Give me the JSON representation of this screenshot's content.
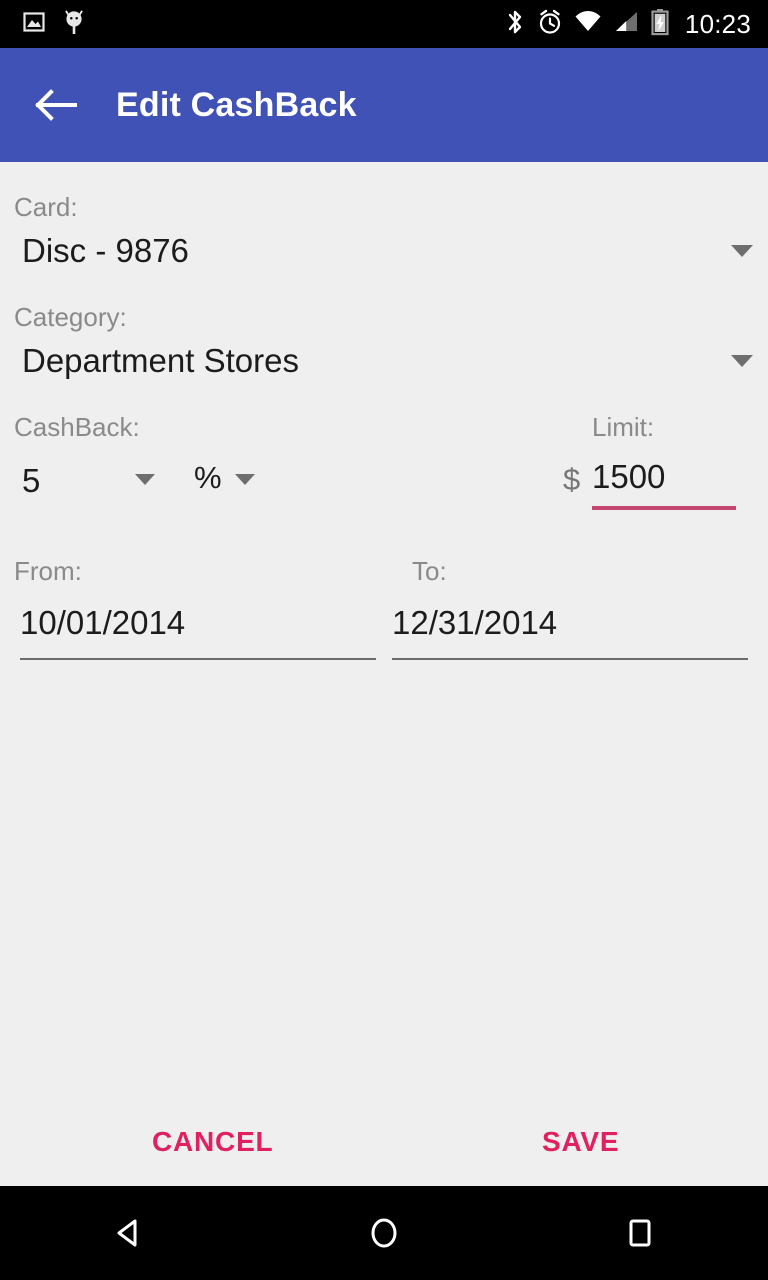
{
  "status_bar": {
    "clock": "10:23",
    "left_icons": [
      "image-icon",
      "android-debug-icon"
    ],
    "right_icons": [
      "bluetooth-icon",
      "alarm-icon",
      "wifi-icon",
      "cell-signal-icon",
      "battery-charging-icon"
    ]
  },
  "app_bar": {
    "title": "Edit CashBack",
    "back_icon": "arrow-left-icon",
    "background_color": "#4052b5",
    "title_color": "#ffffff"
  },
  "form": {
    "card": {
      "label": "Card:",
      "value": "Disc - 9876",
      "dropdown_icon": "chevron-down-icon"
    },
    "category": {
      "label": "Category:",
      "value": "Department Stores",
      "dropdown_icon": "chevron-down-icon"
    },
    "cashback": {
      "label": "CashBack:",
      "value": "5",
      "unit": "%",
      "value_dropdown_icon": "chevron-down-icon",
      "unit_dropdown_icon": "chevron-down-icon"
    },
    "limit": {
      "label": "Limit:",
      "currency_symbol": "$",
      "value": "1500",
      "underline_color": "#c2466f"
    },
    "from": {
      "label": "From:",
      "value": "10/01/2014",
      "underline_color": "#6b6b6b"
    },
    "to": {
      "label": "To:",
      "value": "12/31/2014",
      "underline_color": "#6b6b6b"
    }
  },
  "actions": {
    "cancel_label": "CANCEL",
    "save_label": "SAVE",
    "accent_color": "#e0205f"
  },
  "nav_bar": {
    "back_icon": "nav-back-triangle-icon",
    "home_icon": "nav-home-circle-icon",
    "recents_icon": "nav-recents-square-icon"
  }
}
